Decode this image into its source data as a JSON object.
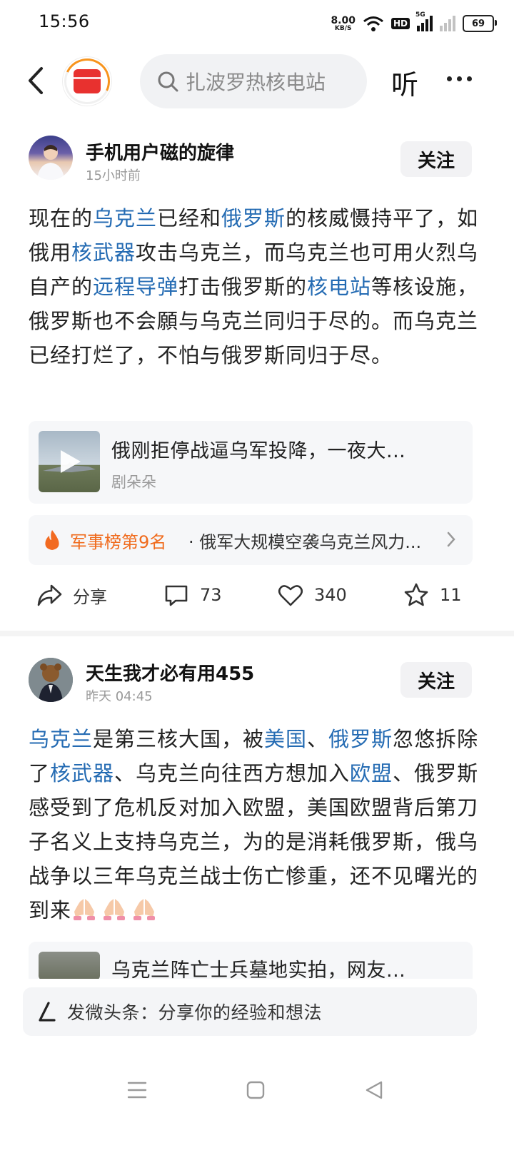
{
  "status_bar": {
    "time": "15:56",
    "speed_value": "8.00",
    "speed_unit": "KB/S",
    "hd": "HD",
    "network": "5G",
    "battery": "69"
  },
  "top_nav": {
    "search_placeholder": "扎波罗热核电站",
    "listen_label": "听"
  },
  "posts": [
    {
      "author": "手机用户磁的旋律",
      "time": "15小时前",
      "follow_label": "关注",
      "body": [
        {
          "t": "现在的"
        },
        {
          "t": "乌克兰",
          "link": true
        },
        {
          "t": "已经和"
        },
        {
          "t": "俄罗斯",
          "link": true
        },
        {
          "t": "的核威慑持平了，如俄用"
        },
        {
          "t": "核武器",
          "link": true
        },
        {
          "t": "攻击乌克兰，而乌克兰也可用火烈乌自产的"
        },
        {
          "t": "远程导弹",
          "link": true
        },
        {
          "t": "打击俄罗斯的"
        },
        {
          "t": "核电站",
          "link": true
        },
        {
          "t": "等核设施，俄罗斯也不会願与乌克兰同归于尽的。而乌克兰已经打烂了，不怕与俄罗斯同归于尽。"
        }
      ],
      "link_card": {
        "title": "俄刚拒停战逼乌军投降，一夜大...",
        "source": "剧朵朵"
      },
      "rank_card": {
        "label": "军事榜第9名",
        "text": "· 俄军大规模空袭乌克兰风力..."
      },
      "actions": {
        "share": "分享",
        "comments": "73",
        "likes": "340",
        "favorites": "11"
      }
    },
    {
      "author": "天生我才必有用455",
      "time": "昨天  04:45",
      "follow_label": "关注",
      "body": [
        {
          "t": "乌克兰",
          "link": true
        },
        {
          "t": "是第三核大国，被"
        },
        {
          "t": "美国",
          "link": true
        },
        {
          "t": "、"
        },
        {
          "t": "俄罗斯",
          "link": true
        },
        {
          "t": "忽悠拆除了"
        },
        {
          "t": "核武器",
          "link": true
        },
        {
          "t": "、乌克兰向往西方想加入"
        },
        {
          "t": "欧盟",
          "link": true
        },
        {
          "t": "、俄罗斯感受到了危机反对加入欧盟，美国欧盟背后第刀子名义上支持乌克兰，为的是消耗俄罗斯，俄乌战争以三年乌克兰战士伤亡惨重，还不见曙光的到来"
        }
      ],
      "link_card": {
        "title": "乌克兰阵亡士兵墓地实拍，网友..."
      }
    }
  ],
  "compose_bar": {
    "text": "发微头条：分享你的经验和想法"
  },
  "colors": {
    "link": "#246bb3",
    "rank": "#f06b1d",
    "logo_red": "#e8312f",
    "logo_ring": "#f7941d"
  }
}
